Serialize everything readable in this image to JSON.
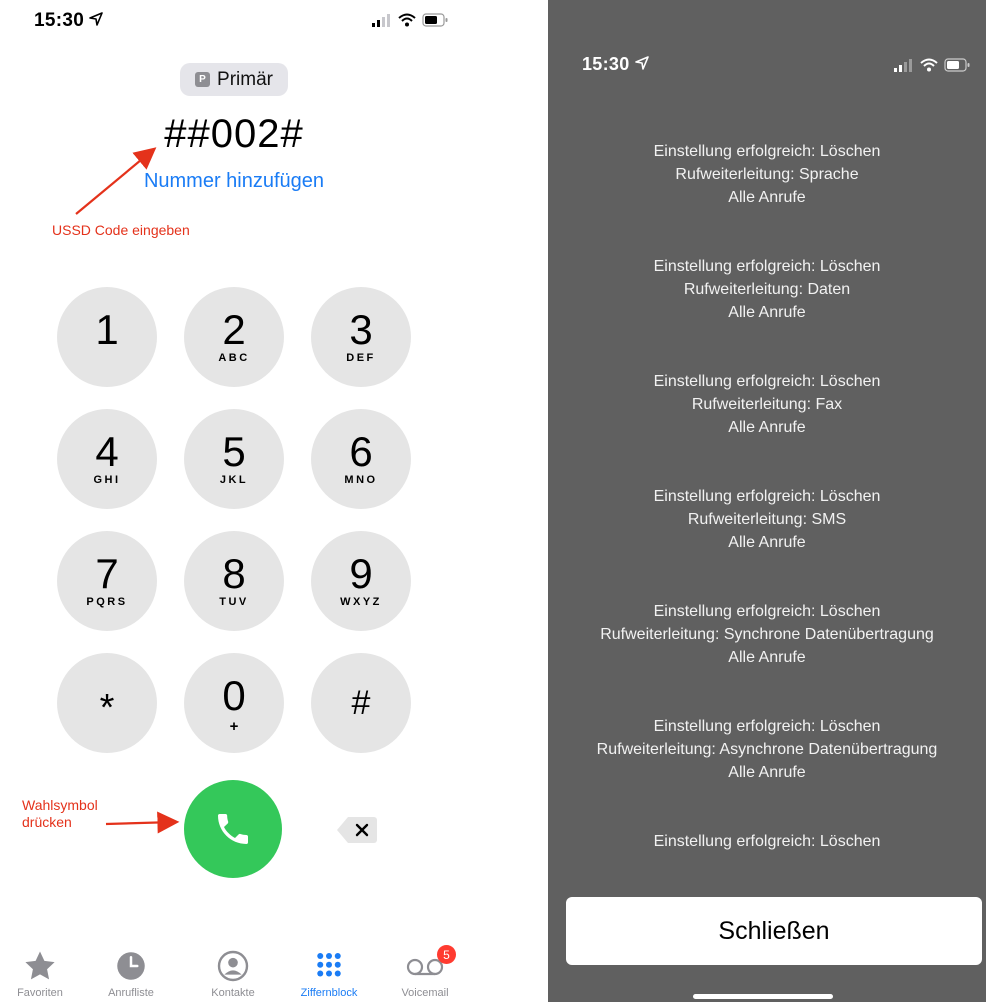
{
  "dialer": {
    "status": {
      "time": "15:30"
    },
    "line_label": "Primär",
    "line_badge": "P",
    "number": "##002#",
    "add_number_label": "Nummer hinzufügen",
    "annotations": {
      "ussd": "USSD Code eingeben",
      "call": "Wahlsymbol\ndrücken"
    },
    "keys": [
      {
        "digit": "1",
        "letters": ""
      },
      {
        "digit": "2",
        "letters": "ABC"
      },
      {
        "digit": "3",
        "letters": "DEF"
      },
      {
        "digit": "4",
        "letters": "GHI"
      },
      {
        "digit": "5",
        "letters": "JKL"
      },
      {
        "digit": "6",
        "letters": "MNO"
      },
      {
        "digit": "7",
        "letters": "PQRS"
      },
      {
        "digit": "8",
        "letters": "TUV"
      },
      {
        "digit": "9",
        "letters": "WXYZ"
      },
      {
        "digit": "*",
        "letters": ""
      },
      {
        "digit": "0",
        "letters": "+"
      },
      {
        "digit": "#",
        "letters": ""
      }
    ],
    "tabs": [
      {
        "label": "Favoriten",
        "icon": "star-icon"
      },
      {
        "label": "Anrufliste",
        "icon": "clock-icon"
      },
      {
        "label": "Kontakte",
        "icon": "contact-icon"
      },
      {
        "label": "Ziffernblock",
        "icon": "keypad-icon"
      },
      {
        "label": "Voicemail",
        "icon": "voicemail-icon",
        "badge": "5"
      }
    ],
    "colors": {
      "accent": "#1a7cf5",
      "call": "#34c85a",
      "annotation": "#e4321b"
    }
  },
  "result": {
    "status": {
      "time": "15:30"
    },
    "messages": [
      {
        "line1": "Einstellung erfolgreich: Löschen",
        "line2": "Rufweiterleitung: Sprache",
        "line3": "Alle Anrufe"
      },
      {
        "line1": "Einstellung erfolgreich: Löschen",
        "line2": "Rufweiterleitung: Daten",
        "line3": "Alle Anrufe"
      },
      {
        "line1": "Einstellung erfolgreich: Löschen",
        "line2": "Rufweiterleitung: Fax",
        "line3": "Alle Anrufe"
      },
      {
        "line1": "Einstellung erfolgreich: Löschen",
        "line2": "Rufweiterleitung: SMS",
        "line3": "Alle Anrufe"
      },
      {
        "line1": "Einstellung erfolgreich: Löschen",
        "line2": "Rufweiterleitung: Synchrone Datenübertragung",
        "line3": "Alle Anrufe"
      },
      {
        "line1": "Einstellung erfolgreich: Löschen",
        "line2": "Rufweiterleitung: Asynchrone Datenübertragung",
        "line3": "Alle Anrufe"
      },
      {
        "line1": "Einstellung erfolgreich: Löschen",
        "line2": "",
        "line3": ""
      }
    ],
    "close_label": "Schließen",
    "colors": {
      "background": "#606060"
    }
  }
}
